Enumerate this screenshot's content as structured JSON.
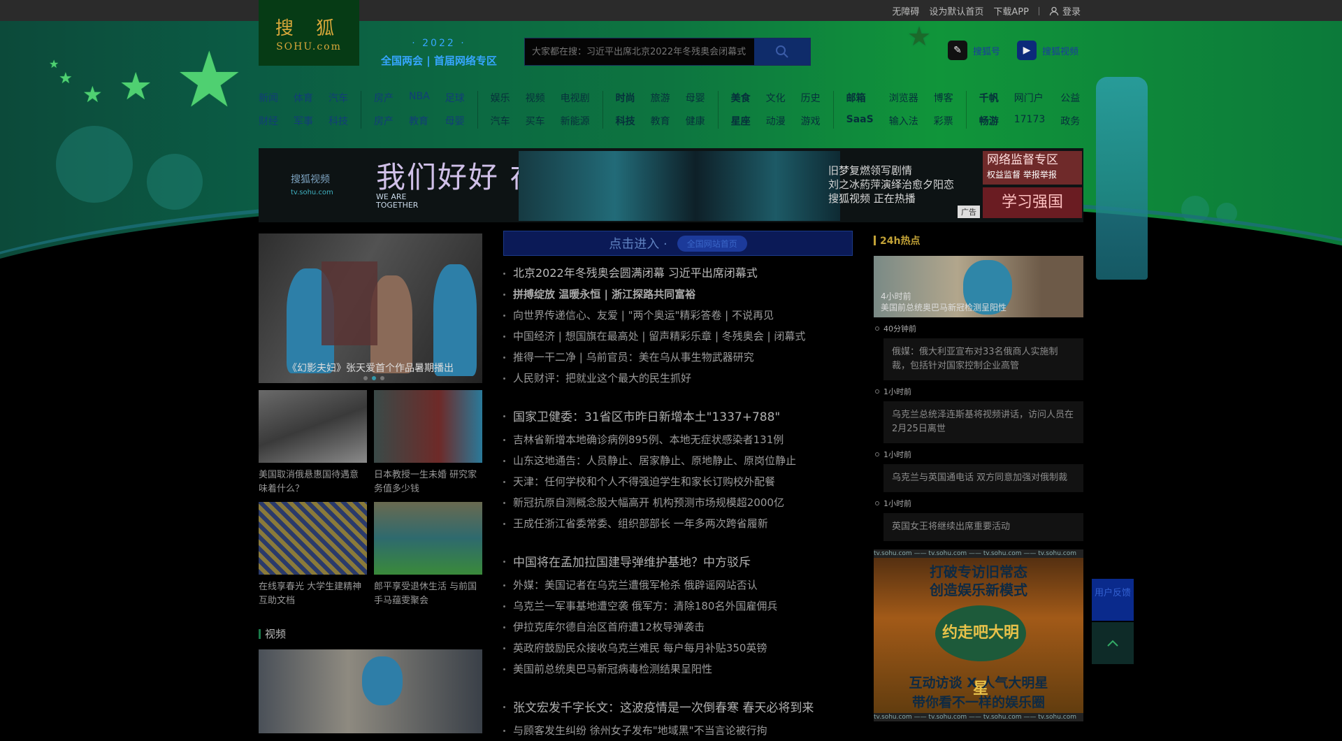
{
  "topbar": {
    "links": [
      "无障碍",
      "设为默认首页",
      "下载APP"
    ],
    "login": "登录"
  },
  "logo": {
    "cn": "搜 狐",
    "en": "SOHU.com"
  },
  "slogan": {
    "year": "· 2022 ·",
    "title": "全国两会 | 首届网络专区"
  },
  "search": {
    "placeholder": "大家都在搜：习近平出席北京2022年冬残奥会闭幕式"
  },
  "apps": [
    {
      "label": "搜狐号",
      "icon": "sohu-account-icon"
    },
    {
      "label": "搜狐视频",
      "icon": "sohu-video-icon"
    }
  ],
  "nav": [
    [
      "新闻",
      "体育",
      "汽车",
      "财经",
      "军事",
      "科技"
    ],
    [
      "房产",
      "NBA",
      "足球",
      "房产",
      "教育",
      "母婴"
    ],
    [
      "娱乐",
      "视频",
      "电视剧",
      "汽车",
      "买车",
      "新能源"
    ],
    [
      "时尚",
      "旅游",
      "母婴",
      "科技",
      "教育",
      "健康"
    ],
    [
      "美食",
      "文化",
      "历史",
      "星座",
      "动漫",
      "游戏"
    ],
    [
      "邮箱",
      "浏览器",
      "博客",
      "SaaS",
      "输入法",
      "彩票"
    ],
    [
      "千帆",
      "网门户",
      "公益",
      "畅游",
      "17173",
      "政务"
    ]
  ],
  "banner": {
    "brand": "搜狐视频",
    "brand_url": "tv.sohu.com",
    "slogan": "我们好好 在一起",
    "slogan_en": "WE ARE TOGETHER",
    "tv_lines": [
      "旧梦复燃领写剧情",
      "刘之冰葯萍演绎治愈夕阳恋",
      "搜狐视频 正在热播"
    ],
    "ad_tag": "广告",
    "right_top": "网络监督专区",
    "right_top_sub": "权益监督  举报举报",
    "right_bottom": "学习强国"
  },
  "feature": {
    "caption": "《幻影夫妇》张天爱首个作品暑期播出"
  },
  "thumbs": [
    {
      "text": "美国取消俄悬惠国待遇意味着什么？"
    },
    {
      "text": "日本教授一生未婚 研究家务值多少钱"
    },
    {
      "text": "在线享春光 大学生建精神互助文档"
    },
    {
      "text": "郎平享受退休生活 与前国手马蕴雯聚会"
    }
  ],
  "video_section": {
    "title": "视频"
  },
  "entry": {
    "label": "点击进入 ·",
    "pill": "全国网站首页"
  },
  "news_groups": [
    [
      {
        "text": "北京2022年冬残奥会圆满闭幕 习近平出席闭幕式",
        "cls": "head"
      },
      {
        "text": "拼搏绽放 温暖永恒 | 浙江探路共同富裕",
        "cls": "bold"
      },
      {
        "text": "向世界传递信心、友爱 | \"两个奥运\"精彩答卷 | 不说再见",
        "cls": ""
      },
      {
        "text": "中国经济 | 想国旗在最高处 | 留声精彩乐章 | 冬残奥会 | 闭幕式",
        "cls": ""
      },
      {
        "text": "推得一干二净 | 乌前官员：美在乌从事生物武器研究",
        "cls": ""
      },
      {
        "text": "人民财评：把就业这个最大的民生抓好",
        "cls": ""
      }
    ],
    [
      {
        "text": "国家卫健委：31省区市昨日新增本土\"1337+788\"",
        "cls": "big"
      },
      {
        "text": "吉林省新增本地确诊病例895例、本地无症状感染者131例",
        "cls": ""
      },
      {
        "text": "山东这地通告：人员静止、居家静止、原地静止、原岗位静止",
        "cls": ""
      },
      {
        "text": "天津：任何学校和个人不得强迫学生和家长订购校外配餐",
        "cls": ""
      },
      {
        "text": "新冠抗原自测概念股大幅高开 机构预测市场规模超2000亿",
        "cls": ""
      },
      {
        "text": "王成任浙江省委常委、组织部部长 一年多两次跨省履新",
        "cls": ""
      }
    ],
    [
      {
        "text": "中国将在孟加拉国建导弹维护基地？中方驳斥",
        "cls": "big"
      },
      {
        "text": "外媒：美国记者在乌克兰遭俄军枪杀 俄辟谣网站否认",
        "cls": ""
      },
      {
        "text": "乌克兰一军事基地遭空袭 俄军方：清除180名外国雇佣兵",
        "cls": ""
      },
      {
        "text": "伊拉克库尔德自治区首府遭12枚导弹袭击",
        "cls": ""
      },
      {
        "text": "英政府鼓励民众接收乌克兰难民 每户每月补贴350英镑",
        "cls": ""
      },
      {
        "text": "美国前总统奥巴马新冠病毒检测结果呈阳性",
        "cls": ""
      }
    ],
    [
      {
        "text": "张文宏发千字长文：这波疫情是一次倒春寒 春天必将到来",
        "cls": "big"
      },
      {
        "text": "与顾客发生纠纷 徐州女子发布\"地域黑\"不当言论被行拘",
        "cls": ""
      }
    ]
  ],
  "right": {
    "title": "24h热点",
    "img_caption_time": "4小时前",
    "img_caption": "美国前总统奥巴马新冠检测呈阳性",
    "items": [
      {
        "time": "40分钟前",
        "text": "俄媒：俄大利亚宣布对33名俄商人实施制裁，包括针对国家控制企业高管"
      },
      {
        "time": "1小时前",
        "text": "乌克兰总统泽连斯基将视频讲话，访问人员在2月25日离世"
      },
      {
        "time": "1小时前",
        "text": "乌克兰与英国通电话 双方同意加强对俄制裁"
      },
      {
        "time": "1小时前",
        "text": "英国女王将继续出席重要活动"
      }
    ]
  },
  "right_ad": {
    "strip": "tv.sohu.com —— tv.sohu.com —— tv.sohu.com —— tv.sohu.com",
    "l1": "打破专访旧常态",
    "l2": "创造娱乐新模式",
    "mid": "约走吧大明星",
    "l3": "互动访谈 X 人气大明星",
    "l4": "带你看不一样的娱乐圈"
  },
  "feedback": {
    "label": "用户反馈"
  },
  "colors": {
    "accent_green": "#10953a",
    "topbar": "#2b2b2b",
    "logo_bg": "#063b15"
  }
}
